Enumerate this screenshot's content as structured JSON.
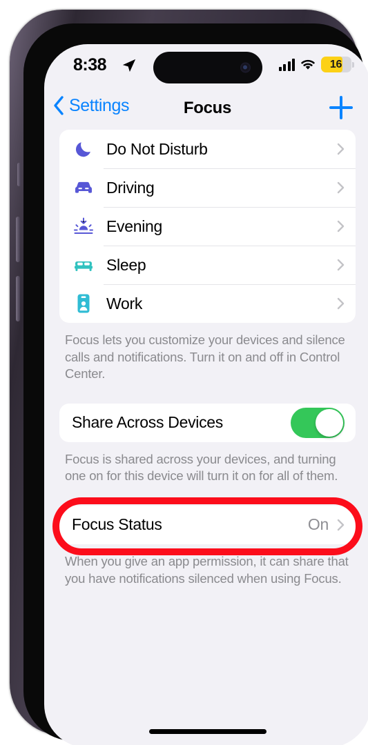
{
  "status_bar": {
    "time": "8:38",
    "location_icon": "location-arrow-icon",
    "signal_icon": "cellular-signal-icon",
    "wifi_icon": "wifi-icon",
    "battery_level": "16",
    "battery_low_power_color": "#fcd116"
  },
  "nav": {
    "back_label": "Settings",
    "title": "Focus",
    "add_label": "+"
  },
  "focus_modes": {
    "items": [
      {
        "label": "Do Not Disturb",
        "icon": "moon-icon",
        "color": "#5757d6"
      },
      {
        "label": "Driving",
        "icon": "car-icon",
        "color": "#5757d6"
      },
      {
        "label": "Evening",
        "icon": "sunset-icon",
        "color": "#5757d6"
      },
      {
        "label": "Sleep",
        "icon": "bed-icon",
        "color": "#30c2bf"
      },
      {
        "label": "Work",
        "icon": "id-badge-icon",
        "color": "#30bcd4"
      }
    ],
    "footnote": "Focus lets you customize your devices and silence calls and notifications. Turn it on and off in Control Center."
  },
  "share_across_devices": {
    "label": "Share Across Devices",
    "toggle_on": true,
    "toggle_color": "#34c759",
    "footnote": "Focus is shared across your devices, and turning one on for this device will turn it on for all of them."
  },
  "focus_status": {
    "label": "Focus Status",
    "value": "On",
    "footnote": "When you give an app permission, it can share that you have notifications silenced when using Focus.",
    "highlight_color": "#fc0d1b"
  },
  "colors": {
    "accent_blue": "#0a84ff",
    "background": "#f2f1f6",
    "card": "#ffffff",
    "secondary_text": "#8a8a8e"
  }
}
